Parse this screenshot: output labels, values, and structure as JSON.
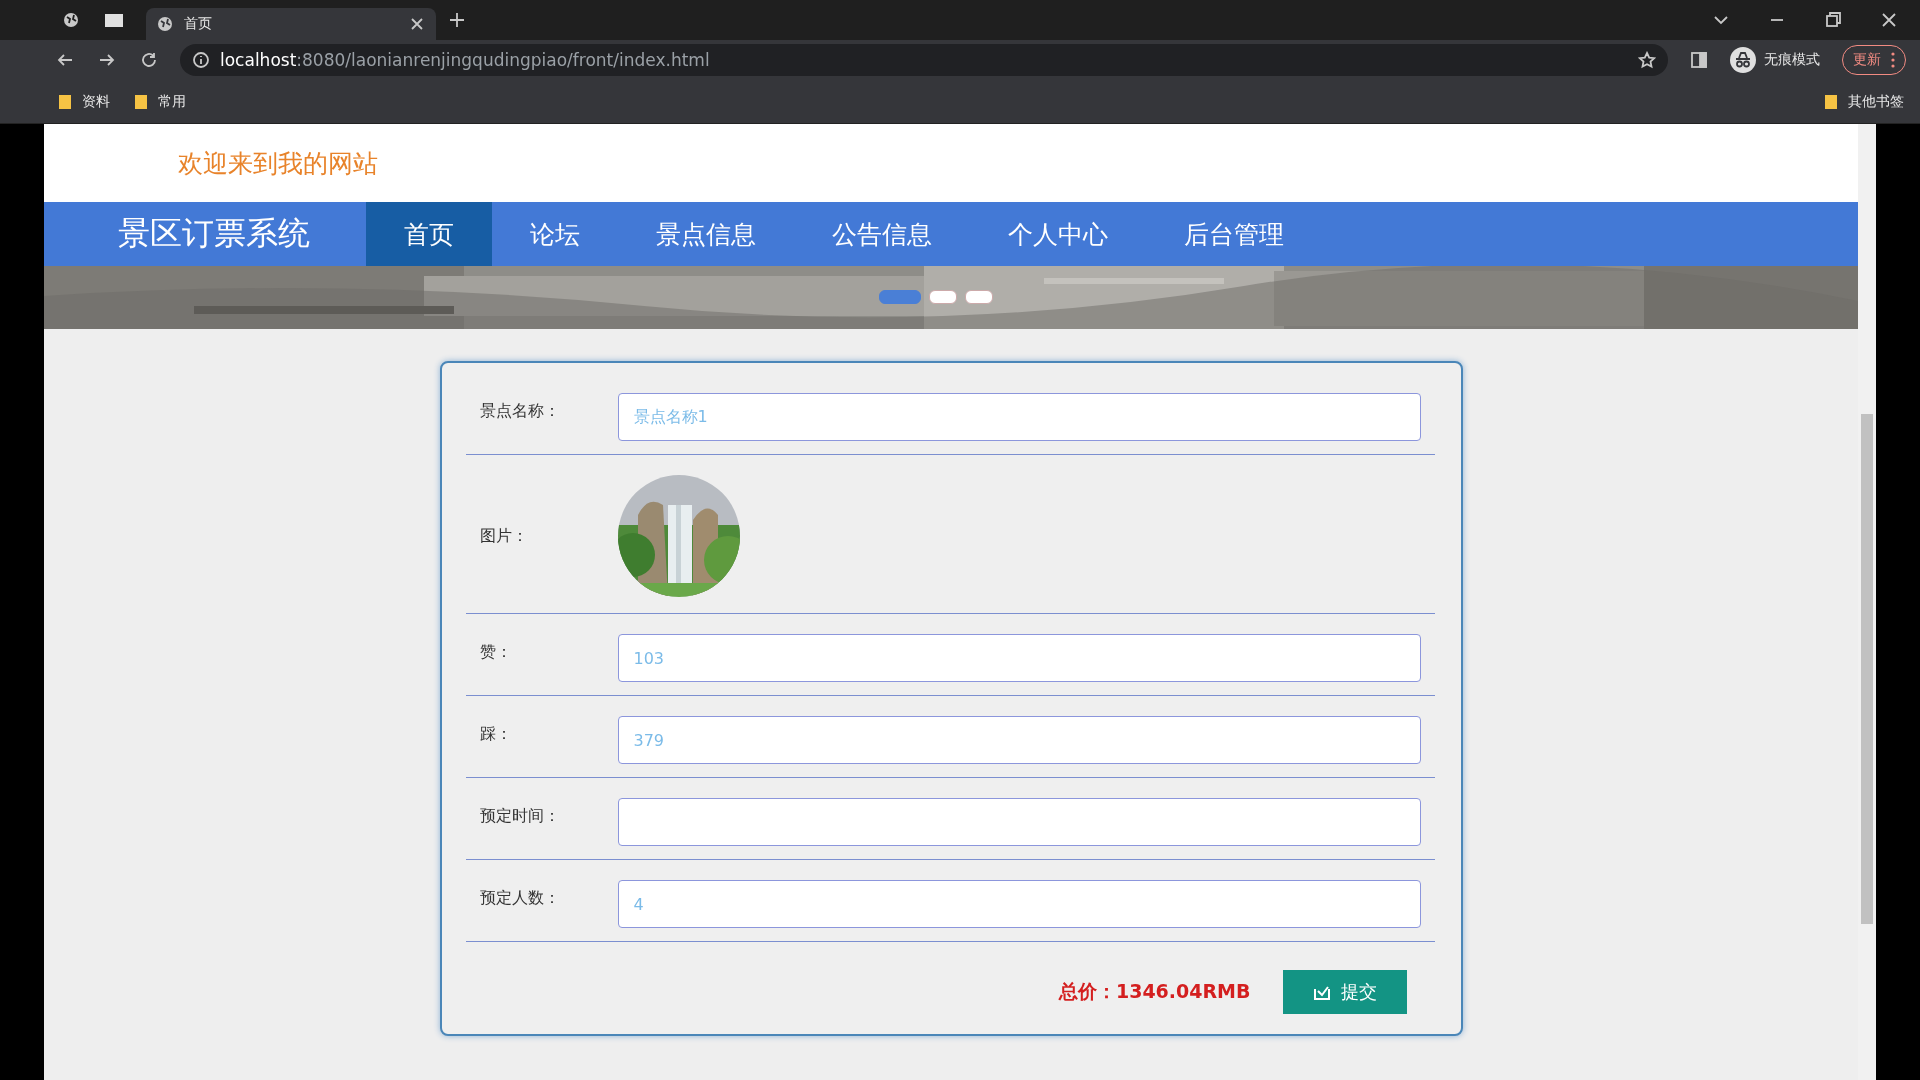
{
  "browser": {
    "tabs": [
      {
        "title": "首页",
        "selected": true
      }
    ],
    "url_host": "localhost",
    "url_path": ":8080/laonianrenjingqudingpiao/front/index.html",
    "profile": "无痕模式",
    "update_button": "更新",
    "bookmarks": [
      "资料",
      "常用"
    ],
    "other_bookmarks": "其他书签"
  },
  "header": {
    "welcome": "欢迎来到我的网站"
  },
  "nav": {
    "brand": "景区订票系统",
    "items": [
      {
        "label": "首页",
        "selected": true
      },
      {
        "label": "论坛",
        "selected": false
      },
      {
        "label": "景点信息",
        "selected": false
      },
      {
        "label": "公告信息",
        "selected": false
      },
      {
        "label": "个人中心",
        "selected": false
      },
      {
        "label": "后台管理",
        "selected": false
      }
    ]
  },
  "banner": {
    "dots": [
      {
        "selected": true
      },
      {
        "selected": false
      },
      {
        "selected": false
      }
    ]
  },
  "form": {
    "fields": [
      {
        "kind": "text",
        "label": "景点名称：",
        "value": "景点名称1"
      },
      {
        "label": "图片："
      },
      {
        "kind": "text",
        "label": "赞：",
        "value": "103"
      },
      {
        "kind": "text",
        "label": "踩：",
        "value": "379"
      },
      {
        "kind": "text",
        "label": "预定时间："
      },
      {
        "kind": "text",
        "label": "预定人数：",
        "value": "4"
      }
    ],
    "total": "总价：1346.04RMB",
    "submit_button": "提交"
  }
}
